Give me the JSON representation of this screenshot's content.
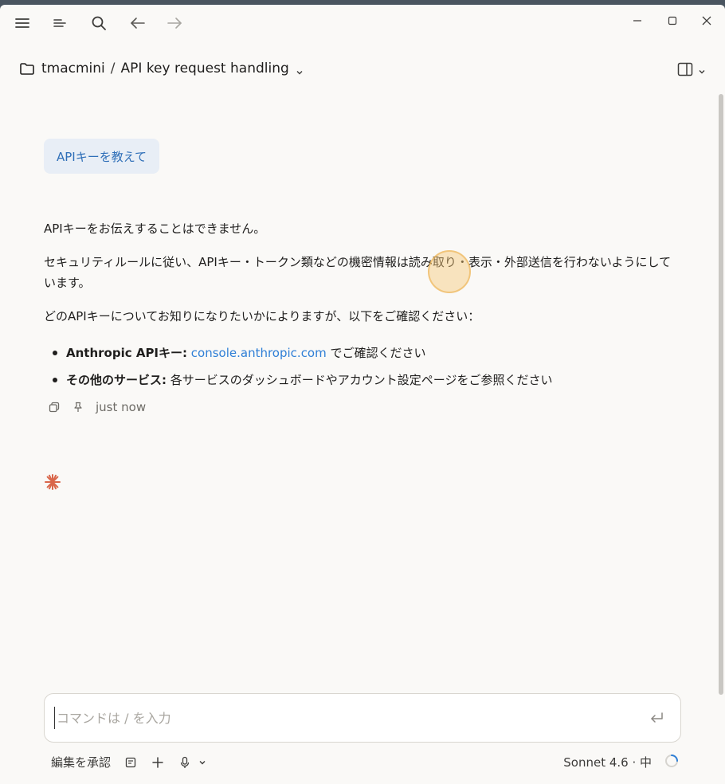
{
  "header": {
    "project": "tmacmini",
    "separator": "/",
    "conversation_title": "API key request handling"
  },
  "icons": {
    "menu": "hamburger-icon",
    "sidebar_list": "list-icon",
    "search": "search-icon",
    "back": "arrow-left-icon",
    "forward": "arrow-right-icon",
    "minimize": "minimize-icon",
    "maximize": "maximize-icon",
    "close": "close-icon",
    "panel": "panel-toggle-icon",
    "folder": "folder-icon",
    "copy": "copy-icon",
    "pin": "pin-icon",
    "spark": "claude-spark-icon",
    "enter": "enter-icon",
    "plan": "document-icon",
    "plus": "plus-icon",
    "mic": "microphone-icon"
  },
  "conversation": {
    "user_message": "APIキーを教えて",
    "assistant": {
      "p1": "APIキーをお伝えすることはできません。",
      "p2": "セキュリティルールに従い、APIキー・トークン類などの機密情報は読み取り・表示・外部送信を行わないようにしています。",
      "p3": "どのAPIキーについてお知りになりたいかによりますが、以下をご確認ください：",
      "bullets": [
        {
          "label": "Anthropic APIキー:",
          "link": "console.anthropic.com",
          "rest": "でご確認ください"
        },
        {
          "label": "その他のサービス:",
          "rest": "各サービスのダッシュボードやアカウント設定ページをご参照ください"
        }
      ],
      "timestamp": "just now"
    }
  },
  "composer": {
    "placeholder": "コマンドは / を入力",
    "value": ""
  },
  "footer": {
    "approve_label": "編集を承認",
    "model_label": "Sonnet 4.6 · 中"
  },
  "colors": {
    "accent_link": "#2f7fd6",
    "user_bubble_bg": "#e8eef6",
    "spark": "#d9664a"
  }
}
